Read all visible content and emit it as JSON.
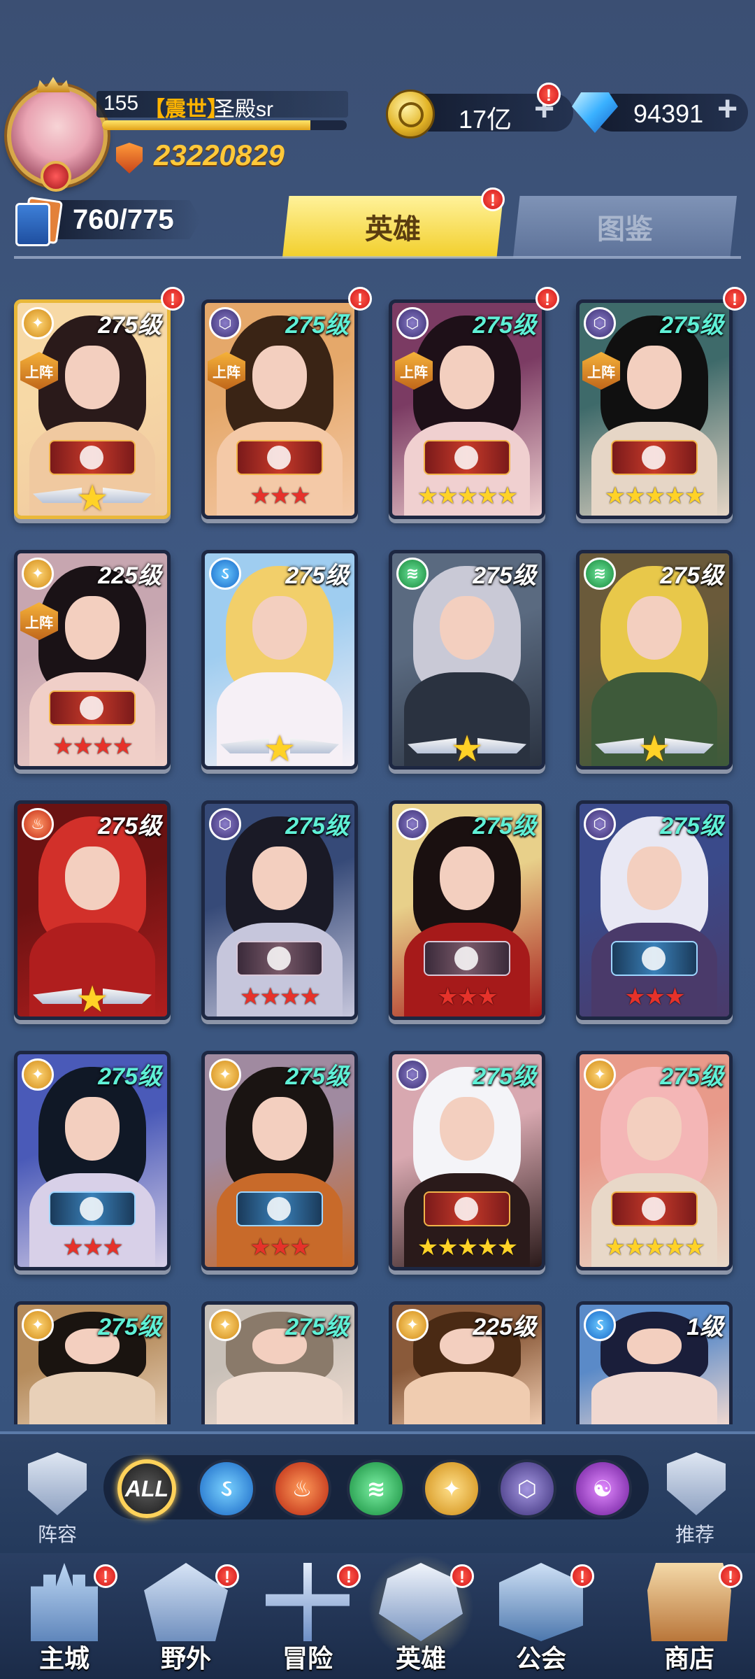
{
  "player": {
    "level": "155",
    "guild_tag": "【震世】",
    "name": "圣殿sr",
    "xp_fraction": 0.85,
    "power": "23220829"
  },
  "resources": {
    "gold": "17亿",
    "diamonds": "94391",
    "plus": "+"
  },
  "hero_count": "760/775",
  "tabs": {
    "heroes": "英雄",
    "codex": "图鉴"
  },
  "badge": "!",
  "on_team_label": "上阵",
  "heroes": [
    {
      "level": "275级",
      "faction": "light",
      "on_team": true,
      "stars": 1,
      "star_style": "wing",
      "emblem": "red",
      "lvl_color": "white",
      "frame": "gold",
      "colors": [
        "#f7d9a6",
        "#2a1a1a",
        "#f0c9a0"
      ]
    },
    {
      "level": "275级",
      "faction": "dark",
      "on_team": true,
      "stars": 3,
      "star_style": "red",
      "emblem": "red",
      "lvl_color": "cyan",
      "frame": "dark",
      "colors": [
        "#e5a86a",
        "#3a2415",
        "#f4c9a7"
      ]
    },
    {
      "level": "275级",
      "faction": "dark",
      "on_team": true,
      "stars": 5,
      "star_style": "gold",
      "emblem": "red",
      "lvl_color": "cyan",
      "frame": "dark",
      "colors": [
        "#7b3b63",
        "#1e1018",
        "#f0d0d0"
      ]
    },
    {
      "level": "275级",
      "faction": "dark",
      "on_team": true,
      "stars": 5,
      "star_style": "gold",
      "emblem": "red",
      "lvl_color": "cyan",
      "frame": "dark",
      "colors": [
        "#3e6a6a",
        "#101010",
        "#e6d6c6"
      ]
    },
    {
      "level": "225级",
      "faction": "light",
      "on_team": true,
      "stars": 4,
      "star_style": "red",
      "emblem": "red",
      "lvl_color": "white",
      "frame": "dark",
      "colors": [
        "#c7a6b0",
        "#1a1216",
        "#f0cfc8"
      ]
    },
    {
      "level": "275级",
      "faction": "water",
      "on_team": false,
      "stars": 1,
      "star_style": "wing",
      "emblem": "none",
      "lvl_color": "white",
      "frame": "dark",
      "colors": [
        "#9fcdf0",
        "#f2cf6a",
        "#f6f0f6"
      ]
    },
    {
      "level": "275级",
      "faction": "wind",
      "on_team": false,
      "stars": 1,
      "star_style": "wing",
      "emblem": "none",
      "lvl_color": "white",
      "frame": "dark",
      "colors": [
        "#5a6a80",
        "#c9c9d6",
        "#2a3240"
      ]
    },
    {
      "level": "275级",
      "faction": "wind",
      "on_team": false,
      "stars": 1,
      "star_style": "wing",
      "emblem": "none",
      "lvl_color": "white",
      "frame": "dark",
      "colors": [
        "#6a5a3a",
        "#e8c84a",
        "#3e5a3a"
      ]
    },
    {
      "level": "275级",
      "faction": "fire",
      "on_team": false,
      "stars": 1,
      "star_style": "wing",
      "emblem": "none",
      "lvl_color": "white",
      "frame": "dark",
      "colors": [
        "#6a1212",
        "#d2302a",
        "#b01e1e"
      ]
    },
    {
      "level": "275级",
      "faction": "dark",
      "on_team": false,
      "stars": 4,
      "star_style": "red",
      "emblem": "dark",
      "lvl_color": "cyan",
      "frame": "dark",
      "colors": [
        "#364a78",
        "#1a1a26",
        "#c6c6dc"
      ]
    },
    {
      "level": "275级",
      "faction": "dark",
      "on_team": false,
      "stars": 3,
      "star_style": "red",
      "emblem": "dark",
      "lvl_color": "cyan",
      "frame": "dark",
      "colors": [
        "#e8d08a",
        "#1a1010",
        "#a61a1a"
      ]
    },
    {
      "level": "275级",
      "faction": "dark",
      "on_team": false,
      "stars": 3,
      "star_style": "red",
      "emblem": "blue",
      "lvl_color": "cyan",
      "frame": "dark",
      "colors": [
        "#3a4a8a",
        "#e8e8f4",
        "#4a3a6a"
      ]
    },
    {
      "level": "275级",
      "faction": "light",
      "on_team": false,
      "stars": 3,
      "star_style": "red",
      "emblem": "blue",
      "lvl_color": "cyan",
      "frame": "dark",
      "colors": [
        "#4a5ab8",
        "#101826",
        "#d8d0e8"
      ]
    },
    {
      "level": "275级",
      "faction": "light",
      "on_team": false,
      "stars": 3,
      "star_style": "red",
      "emblem": "blue",
      "lvl_color": "cyan",
      "frame": "dark",
      "colors": [
        "#a08aa0",
        "#1a1412",
        "#c86a2a"
      ]
    },
    {
      "level": "275级",
      "faction": "dark",
      "on_team": false,
      "stars": 5,
      "star_style": "gold",
      "emblem": "red",
      "lvl_color": "cyan",
      "frame": "dark",
      "colors": [
        "#d8a8b0",
        "#f4f4f8",
        "#2a1a1a"
      ]
    },
    {
      "level": "275级",
      "faction": "light",
      "on_team": false,
      "stars": 5,
      "star_style": "gold",
      "emblem": "red",
      "lvl_color": "cyan",
      "frame": "dark",
      "colors": [
        "#e89a8a",
        "#f4b6b6",
        "#e8d8c8"
      ]
    },
    {
      "level": "275级",
      "faction": "light",
      "on_team": false,
      "stars": 0,
      "star_style": "none",
      "emblem": "none",
      "lvl_color": "cyan",
      "frame": "dark",
      "colors": [
        "#b48a5a",
        "#1a1410",
        "#e8d0b8"
      ]
    },
    {
      "level": "275级",
      "faction": "light",
      "on_team": false,
      "stars": 0,
      "star_style": "none",
      "emblem": "none",
      "lvl_color": "cyan",
      "frame": "dark",
      "colors": [
        "#c8c0b8",
        "#8a7a6a",
        "#f0dcd0"
      ]
    },
    {
      "level": "225级",
      "faction": "light",
      "on_team": false,
      "stars": 0,
      "star_style": "none",
      "emblem": "none",
      "lvl_color": "white",
      "frame": "dark",
      "colors": [
        "#8a5a3a",
        "#4a2a14",
        "#f0ccb0"
      ]
    },
    {
      "level": "1级",
      "faction": "water",
      "on_team": false,
      "stars": 0,
      "star_style": "none",
      "emblem": "none",
      "lvl_color": "white",
      "frame": "dark",
      "colors": [
        "#5a8ac8",
        "#1a1e3a",
        "#f0d8d0"
      ]
    }
  ],
  "filter": {
    "formation_label": "阵容",
    "recommend_label": "推荐",
    "all_label": "ALL",
    "factions": [
      "water-icon",
      "fire-icon",
      "wind-icon",
      "light-icon",
      "dark-icon",
      "chaos-icon"
    ]
  },
  "nav": [
    {
      "label": "主城",
      "icon": "castle-icon",
      "active": false,
      "badge": true
    },
    {
      "label": "野外",
      "icon": "field-icon",
      "active": false,
      "badge": true
    },
    {
      "label": "冒险",
      "icon": "adventure-icon",
      "active": false,
      "badge": true
    },
    {
      "label": "英雄",
      "icon": "hero-icon",
      "active": true,
      "badge": true
    },
    {
      "label": "公会",
      "icon": "guild-icon",
      "active": false,
      "badge": true
    },
    {
      "label": "商店",
      "icon": "shop-icon",
      "active": false,
      "badge": true
    }
  ]
}
